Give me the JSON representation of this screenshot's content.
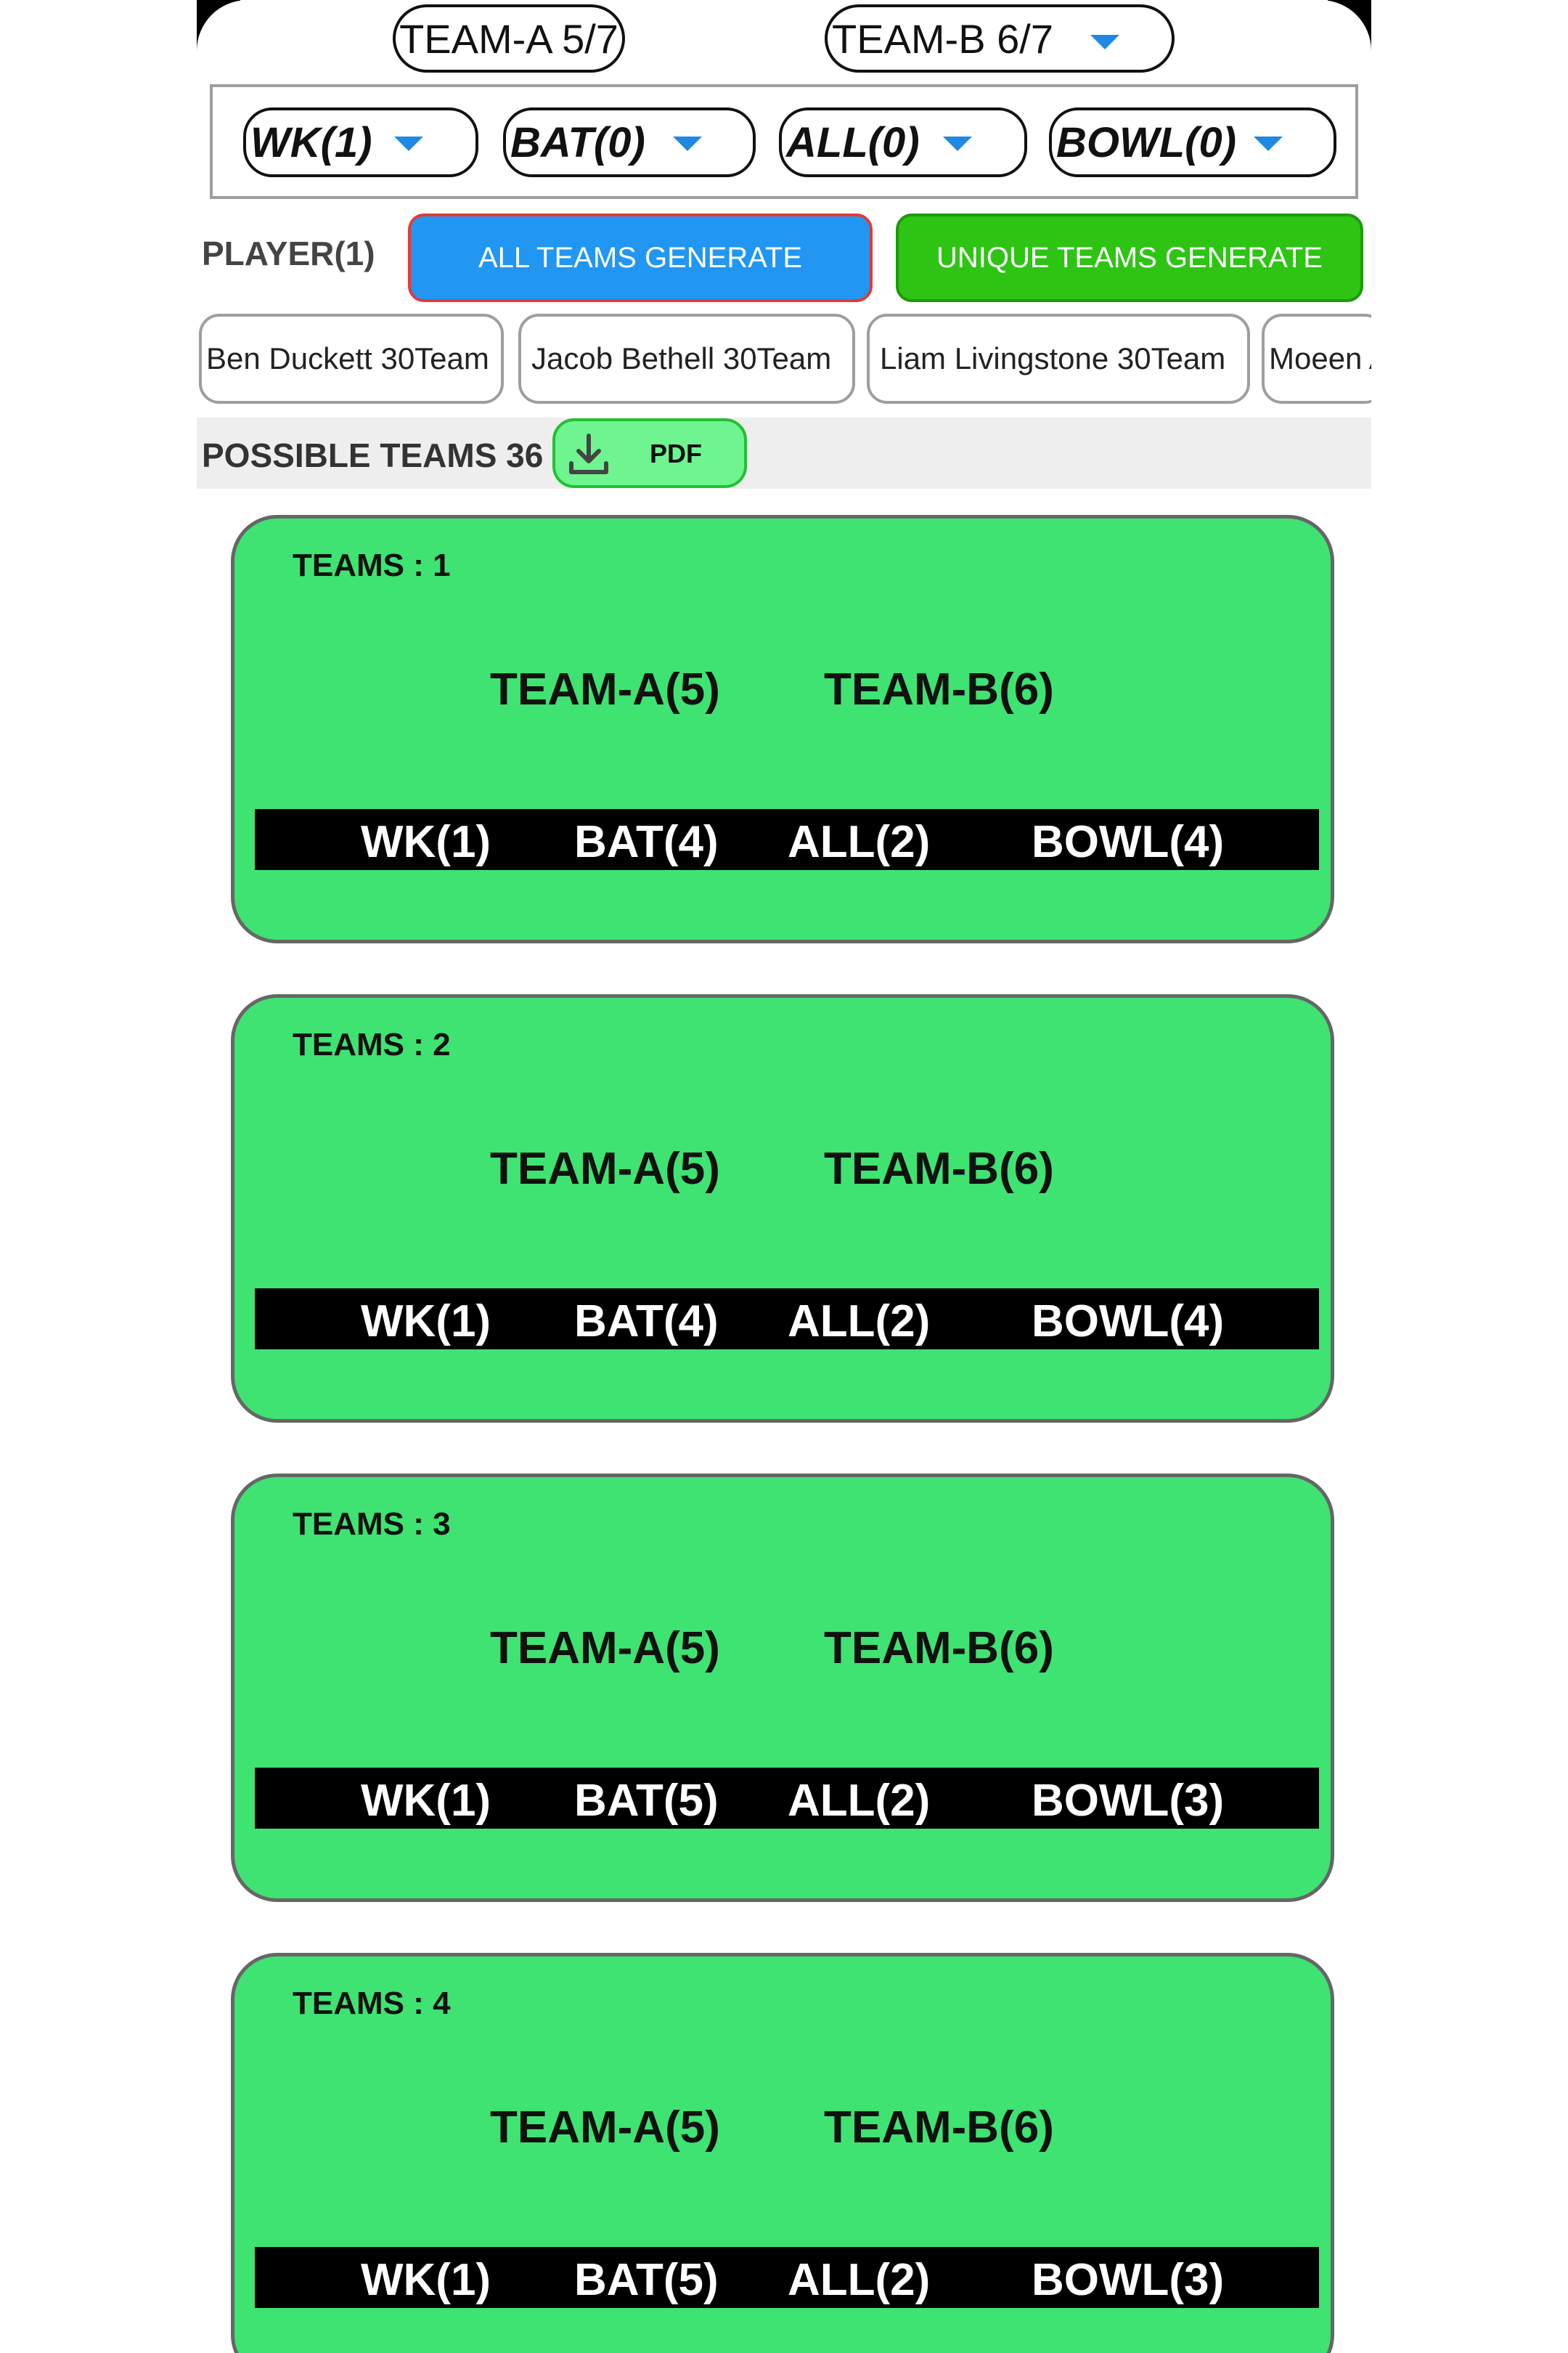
{
  "header": {
    "team_a": "TEAM-A 5/7",
    "team_b": "TEAM-B 6/7"
  },
  "role_filters": [
    {
      "label": "WK(1)"
    },
    {
      "label": "BAT(0)"
    },
    {
      "label": "ALL(0)"
    },
    {
      "label": "BOWL(0)"
    }
  ],
  "player_label": "PLAYER(1)",
  "buttons": {
    "all_teams": "ALL TEAMS GENERATE",
    "unique_teams": "UNIQUE TEAMS GENERATE",
    "pdf": "PDF"
  },
  "player_chips": [
    "Ben Duckett 30Team",
    "Jacob Bethell 30Team",
    "Liam Livingstone 30Team",
    "Moeen A"
  ],
  "possible_teams": "POSSIBLE TEAMS 36",
  "teams": [
    {
      "label": "TEAMS : 1",
      "team_a": "TEAM-A(5)",
      "team_b": "TEAM-B(6)",
      "wk": "WK(1)",
      "bat": "BAT(4)",
      "all": "ALL(2)",
      "bowl": "BOWL(4)"
    },
    {
      "label": "TEAMS : 2",
      "team_a": "TEAM-A(5)",
      "team_b": "TEAM-B(6)",
      "wk": "WK(1)",
      "bat": "BAT(4)",
      "all": "ALL(2)",
      "bowl": "BOWL(4)"
    },
    {
      "label": "TEAMS : 3",
      "team_a": "TEAM-A(5)",
      "team_b": "TEAM-B(6)",
      "wk": "WK(1)",
      "bat": "BAT(5)",
      "all": "ALL(2)",
      "bowl": "BOWL(3)"
    },
    {
      "label": "TEAMS : 4",
      "team_a": "TEAM-A(5)",
      "team_b": "TEAM-B(6)",
      "wk": "WK(1)",
      "bat": "BAT(5)",
      "all": "ALL(2)",
      "bowl": "BOWL(3)"
    }
  ],
  "icons": {
    "dropdown": "chevron-down-icon",
    "download": "download-icon"
  },
  "colors": {
    "accent_blue": "#2196f3",
    "generate_green": "#2ec414",
    "card_green": "#3ee372",
    "pdf_green": "#6ef58f"
  }
}
